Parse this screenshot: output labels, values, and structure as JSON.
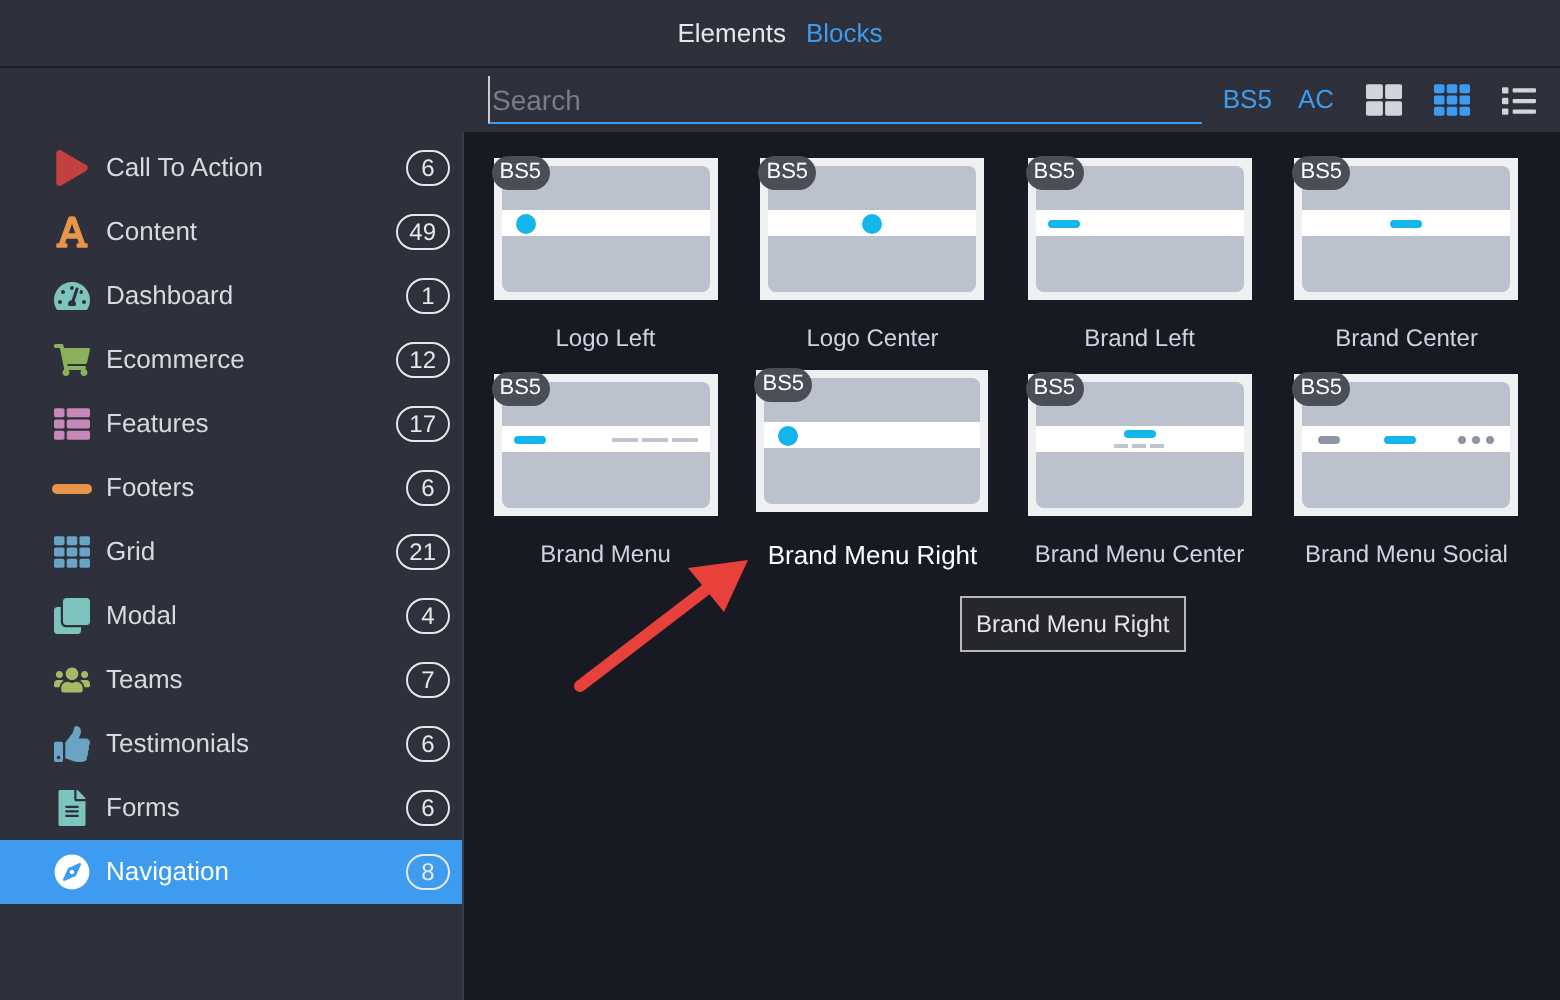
{
  "tabs": [
    {
      "label": "Elements",
      "selected": false
    },
    {
      "label": "Blocks",
      "selected": true
    }
  ],
  "toolbar": {
    "search": {
      "placeholder": "Search"
    },
    "filters": [
      "BS5",
      "AC"
    ],
    "view_buttons": [
      {
        "kind": "large-grid",
        "selected": false
      },
      {
        "kind": "small-grid",
        "selected": true
      },
      {
        "kind": "list",
        "selected": false
      }
    ]
  },
  "sidebar": {
    "items": [
      {
        "label": "Call To Action",
        "count": "6",
        "kind": "play",
        "color": "#c0413f",
        "selected": false
      },
      {
        "label": "Content",
        "count": "49",
        "kind": "font",
        "color": "#e8944a",
        "selected": false
      },
      {
        "label": "Dashboard",
        "count": "1",
        "kind": "gauge",
        "color": "#7cc4bd",
        "selected": false
      },
      {
        "label": "Ecommerce",
        "count": "12",
        "kind": "cart",
        "color": "#8db05a",
        "selected": false
      },
      {
        "label": "Features",
        "count": "17",
        "kind": "list",
        "color": "#c688b8",
        "selected": false
      },
      {
        "label": "Footers",
        "count": "6",
        "kind": "bar",
        "color": "#e8944a",
        "selected": false
      },
      {
        "label": "Grid",
        "count": "21",
        "kind": "grid",
        "color": "#6aa3c4",
        "selected": false
      },
      {
        "label": "Modal",
        "count": "4",
        "kind": "clone",
        "color": "#7cc4bd",
        "selected": false
      },
      {
        "label": "Teams",
        "count": "7",
        "kind": "users",
        "color": "#a8b865",
        "selected": false
      },
      {
        "label": "Testimonials",
        "count": "6",
        "kind": "thumb",
        "color": "#6aa3c4",
        "selected": false
      },
      {
        "label": "Forms",
        "count": "6",
        "kind": "file",
        "color": "#7cc4bd",
        "selected": false
      },
      {
        "label": "Navigation",
        "count": "8",
        "kind": "compass",
        "color": "#ffffff",
        "selected": true
      }
    ]
  },
  "blocks": [
    {
      "label": "Logo Left",
      "badge": "BS5",
      "kind": "logo-left",
      "hovered": false
    },
    {
      "label": "Logo Center",
      "badge": "BS5",
      "kind": "logo-center",
      "hovered": false
    },
    {
      "label": "Brand Left",
      "badge": "BS5",
      "kind": "brand-left",
      "hovered": false
    },
    {
      "label": "Brand Center",
      "badge": "BS5",
      "kind": "brand-center",
      "hovered": false
    },
    {
      "label": "Brand Menu",
      "badge": "BS5",
      "kind": "brand-menu",
      "hovered": false
    },
    {
      "label": "Brand Menu Right",
      "badge": "BS5",
      "kind": "logo-left",
      "hovered": true
    },
    {
      "label": "Brand Menu Center",
      "badge": "BS5",
      "kind": "brand-menu-center",
      "hovered": false
    },
    {
      "label": "Brand Menu Social",
      "badge": "BS5",
      "kind": "brand-menu-social",
      "hovered": false
    }
  ],
  "tooltip": "Brand Menu Right"
}
